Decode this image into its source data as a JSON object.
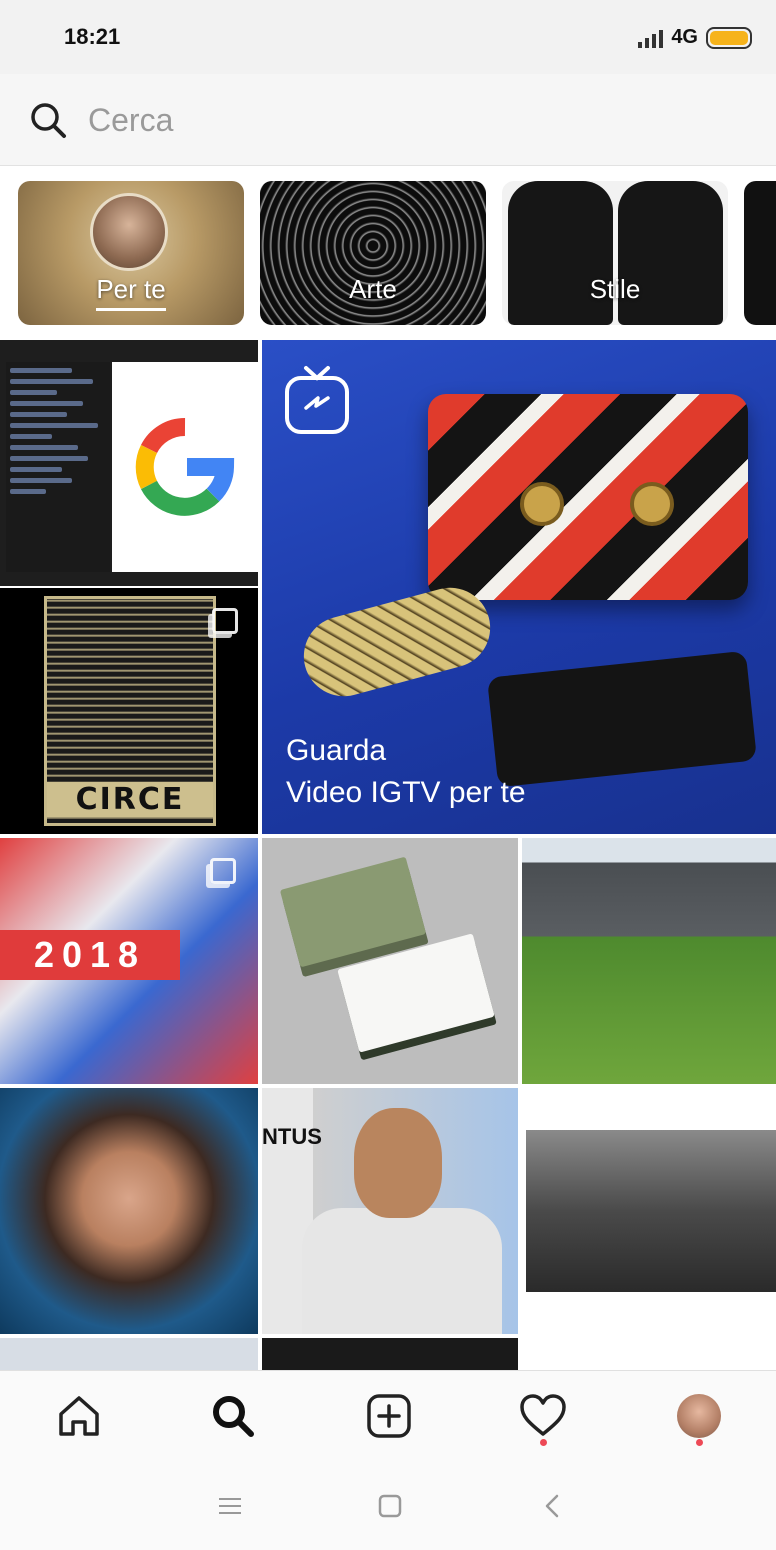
{
  "status_bar": {
    "time": "18:21",
    "network": "4G",
    "battery_color": "#f6b31b"
  },
  "search": {
    "placeholder": "Cerca"
  },
  "topics": [
    {
      "label": "Per te"
    },
    {
      "label": "Arte"
    },
    {
      "label": "Stile"
    }
  ],
  "grid": {
    "igtv_title_line1": "Guarda",
    "igtv_title_line2": "Video IGTV per te",
    "circe_text": "CIRCE",
    "poster_text": "2018",
    "juventus_text": "NTUS"
  },
  "bottom_nav": {
    "items": [
      "home-icon",
      "search-icon",
      "add-icon",
      "heart-icon",
      "profile-avatar"
    ],
    "notification_color": "#ed4956"
  },
  "system_nav": {
    "items": [
      "menu-icon",
      "home-square-icon",
      "back-icon"
    ]
  }
}
